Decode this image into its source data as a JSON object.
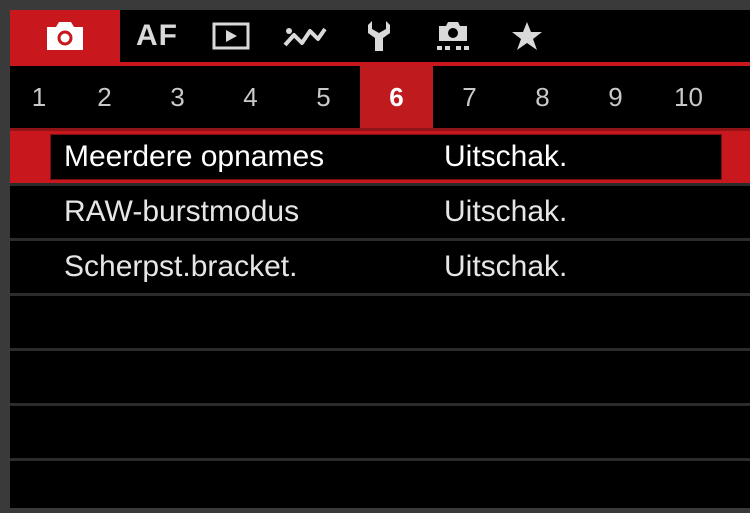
{
  "main_tabs": [
    {
      "id": "shooting",
      "icon": "camera-icon",
      "active": true
    },
    {
      "id": "af",
      "label": "AF"
    },
    {
      "id": "playback",
      "icon": "playback-icon"
    },
    {
      "id": "custom-functions",
      "icon": "wireless-icon"
    },
    {
      "id": "setup",
      "icon": "wrench-icon"
    },
    {
      "id": "custom-shooting",
      "icon": "custom-camera-icon"
    },
    {
      "id": "my-menu",
      "icon": "star-icon"
    }
  ],
  "page_tabs": [
    "1",
    "2",
    "3",
    "4",
    "5",
    "6",
    "7",
    "8",
    "9",
    "10"
  ],
  "active_page": "6",
  "menu_items": [
    {
      "label": "Meerdere opnames",
      "value": "Uitschak.",
      "selected": true
    },
    {
      "label": "RAW-burstmodus",
      "value": "Uitschak."
    },
    {
      "label": "Scherpst.bracket.",
      "value": "Uitschak."
    }
  ],
  "colors": {
    "accent": "#c8171d",
    "background": "#000000",
    "text": "#e6e6e6"
  }
}
